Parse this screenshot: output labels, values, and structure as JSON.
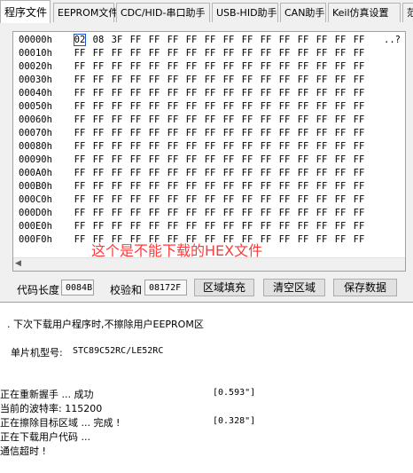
{
  "tabs": [
    {
      "label": "程序文件",
      "active": true
    },
    {
      "label": "EEPROM文件"
    },
    {
      "label": "CDC/HID-串口助手"
    },
    {
      "label": "USB-HID助手"
    },
    {
      "label": "CAN助手"
    },
    {
      "label": "Keil仿真设置"
    },
    {
      "label": "范"
    }
  ],
  "hex": {
    "rows": [
      {
        "addr": "00000h",
        "bytes": [
          "02",
          "08",
          "3F",
          "FF",
          "FF",
          "FF",
          "FF",
          "FF",
          "FF",
          "FF",
          "FF",
          "FF",
          "FF",
          "FF",
          "FF",
          "FF"
        ],
        "ascii": "..?"
      },
      {
        "addr": "00010h",
        "bytes": [
          "FF",
          "FF",
          "FF",
          "FF",
          "FF",
          "FF",
          "FF",
          "FF",
          "FF",
          "FF",
          "FF",
          "FF",
          "FF",
          "FF",
          "FF",
          "FF"
        ],
        "ascii": ""
      },
      {
        "addr": "00020h",
        "bytes": [
          "FF",
          "FF",
          "FF",
          "FF",
          "FF",
          "FF",
          "FF",
          "FF",
          "FF",
          "FF",
          "FF",
          "FF",
          "FF",
          "FF",
          "FF",
          "FF"
        ],
        "ascii": ""
      },
      {
        "addr": "00030h",
        "bytes": [
          "FF",
          "FF",
          "FF",
          "FF",
          "FF",
          "FF",
          "FF",
          "FF",
          "FF",
          "FF",
          "FF",
          "FF",
          "FF",
          "FF",
          "FF",
          "FF"
        ],
        "ascii": ""
      },
      {
        "addr": "00040h",
        "bytes": [
          "FF",
          "FF",
          "FF",
          "FF",
          "FF",
          "FF",
          "FF",
          "FF",
          "FF",
          "FF",
          "FF",
          "FF",
          "FF",
          "FF",
          "FF",
          "FF"
        ],
        "ascii": ""
      },
      {
        "addr": "00050h",
        "bytes": [
          "FF",
          "FF",
          "FF",
          "FF",
          "FF",
          "FF",
          "FF",
          "FF",
          "FF",
          "FF",
          "FF",
          "FF",
          "FF",
          "FF",
          "FF",
          "FF"
        ],
        "ascii": ""
      },
      {
        "addr": "00060h",
        "bytes": [
          "FF",
          "FF",
          "FF",
          "FF",
          "FF",
          "FF",
          "FF",
          "FF",
          "FF",
          "FF",
          "FF",
          "FF",
          "FF",
          "FF",
          "FF",
          "FF"
        ],
        "ascii": ""
      },
      {
        "addr": "00070h",
        "bytes": [
          "FF",
          "FF",
          "FF",
          "FF",
          "FF",
          "FF",
          "FF",
          "FF",
          "FF",
          "FF",
          "FF",
          "FF",
          "FF",
          "FF",
          "FF",
          "FF"
        ],
        "ascii": ""
      },
      {
        "addr": "00080h",
        "bytes": [
          "FF",
          "FF",
          "FF",
          "FF",
          "FF",
          "FF",
          "FF",
          "FF",
          "FF",
          "FF",
          "FF",
          "FF",
          "FF",
          "FF",
          "FF",
          "FF"
        ],
        "ascii": ""
      },
      {
        "addr": "00090h",
        "bytes": [
          "FF",
          "FF",
          "FF",
          "FF",
          "FF",
          "FF",
          "FF",
          "FF",
          "FF",
          "FF",
          "FF",
          "FF",
          "FF",
          "FF",
          "FF",
          "FF"
        ],
        "ascii": ""
      },
      {
        "addr": "000A0h",
        "bytes": [
          "FF",
          "FF",
          "FF",
          "FF",
          "FF",
          "FF",
          "FF",
          "FF",
          "FF",
          "FF",
          "FF",
          "FF",
          "FF",
          "FF",
          "FF",
          "FF"
        ],
        "ascii": ""
      },
      {
        "addr": "000B0h",
        "bytes": [
          "FF",
          "FF",
          "FF",
          "FF",
          "FF",
          "FF",
          "FF",
          "FF",
          "FF",
          "FF",
          "FF",
          "FF",
          "FF",
          "FF",
          "FF",
          "FF"
        ],
        "ascii": ""
      },
      {
        "addr": "000C0h",
        "bytes": [
          "FF",
          "FF",
          "FF",
          "FF",
          "FF",
          "FF",
          "FF",
          "FF",
          "FF",
          "FF",
          "FF",
          "FF",
          "FF",
          "FF",
          "FF",
          "FF"
        ],
        "ascii": ""
      },
      {
        "addr": "000D0h",
        "bytes": [
          "FF",
          "FF",
          "FF",
          "FF",
          "FF",
          "FF",
          "FF",
          "FF",
          "FF",
          "FF",
          "FF",
          "FF",
          "FF",
          "FF",
          "FF",
          "FF"
        ],
        "ascii": ""
      },
      {
        "addr": "000E0h",
        "bytes": [
          "FF",
          "FF",
          "FF",
          "FF",
          "FF",
          "FF",
          "FF",
          "FF",
          "FF",
          "FF",
          "FF",
          "FF",
          "FF",
          "FF",
          "FF",
          "FF"
        ],
        "ascii": ""
      },
      {
        "addr": "000F0h",
        "bytes": [
          "FF",
          "FF",
          "FF",
          "FF",
          "FF",
          "FF",
          "FF",
          "FF",
          "FF",
          "FF",
          "FF",
          "FF",
          "FF",
          "FF",
          "FF",
          "FF"
        ],
        "ascii": ""
      }
    ],
    "selection_color": "#1a4fd8"
  },
  "overlay_text": "这个是不能下载的HEX文件",
  "overlay_color": "#ff3a3a",
  "bottom": {
    "code_length_label": "代码长度",
    "code_length_value": "0084B",
    "checksum_label": "校验和",
    "checksum_value": "08172F",
    "fill_button": "区域填充",
    "clear_button": "清空区域",
    "save_button": "保存数据"
  },
  "log": {
    "option_line": ". 下次下载用户程序时,不擦除用户EEPROM区",
    "mcu_label": "单片机型号:",
    "mcu_value": "STC89C52RC/LE52RC",
    "lines": [
      {
        "text": "正在重新握手 ... 成功",
        "time": "[0.593\"]"
      },
      {
        "text": "当前的波特率: 115200",
        "time": ""
      },
      {
        "text": "正在擦除目标区域 ... 完成 !",
        "time": "[0.328\"]"
      },
      {
        "text": "正在下载用户代码 ...",
        "time": ""
      },
      {
        "text": "通信超时 !",
        "time": ""
      }
    ]
  }
}
